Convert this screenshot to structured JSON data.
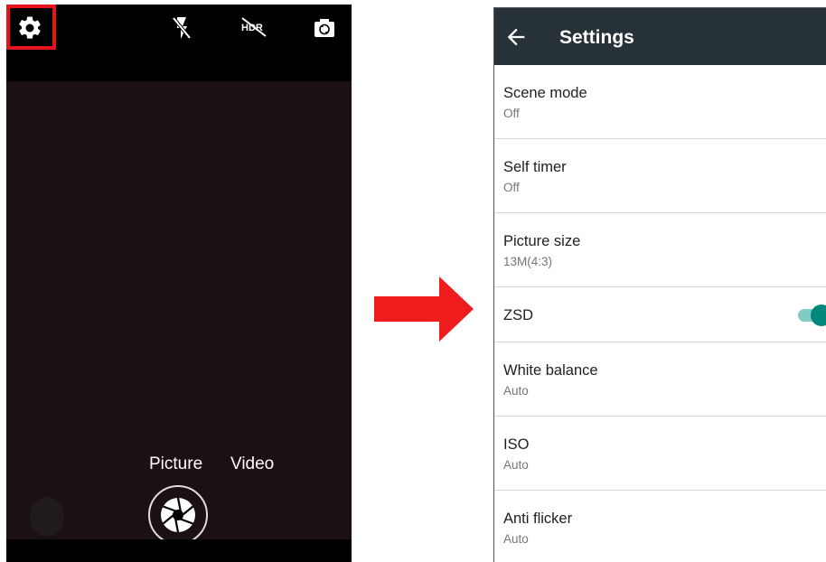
{
  "camera": {
    "icons": [
      "gear-icon",
      "flash-off-icon",
      "hdr-off-icon",
      "switch-camera-icon",
      "shutter-icon"
    ],
    "modes": {
      "picture": "Picture",
      "video": "Video"
    },
    "highlight_color": "#e8141c"
  },
  "arrow_color": "#ee1c1c",
  "settings": {
    "title": "Settings",
    "items": [
      {
        "label": "Scene mode",
        "value": "Off"
      },
      {
        "label": "Self timer",
        "value": "Off"
      },
      {
        "label": "Picture size",
        "value": "13M(4:3)"
      },
      {
        "label": "ZSD",
        "value": "",
        "toggle": true
      },
      {
        "label": "White balance",
        "value": "Auto"
      },
      {
        "label": "ISO",
        "value": "Auto"
      },
      {
        "label": "Anti flicker",
        "value": "Auto"
      }
    ],
    "appbar_color": "#263238",
    "accent": "#00897b"
  }
}
